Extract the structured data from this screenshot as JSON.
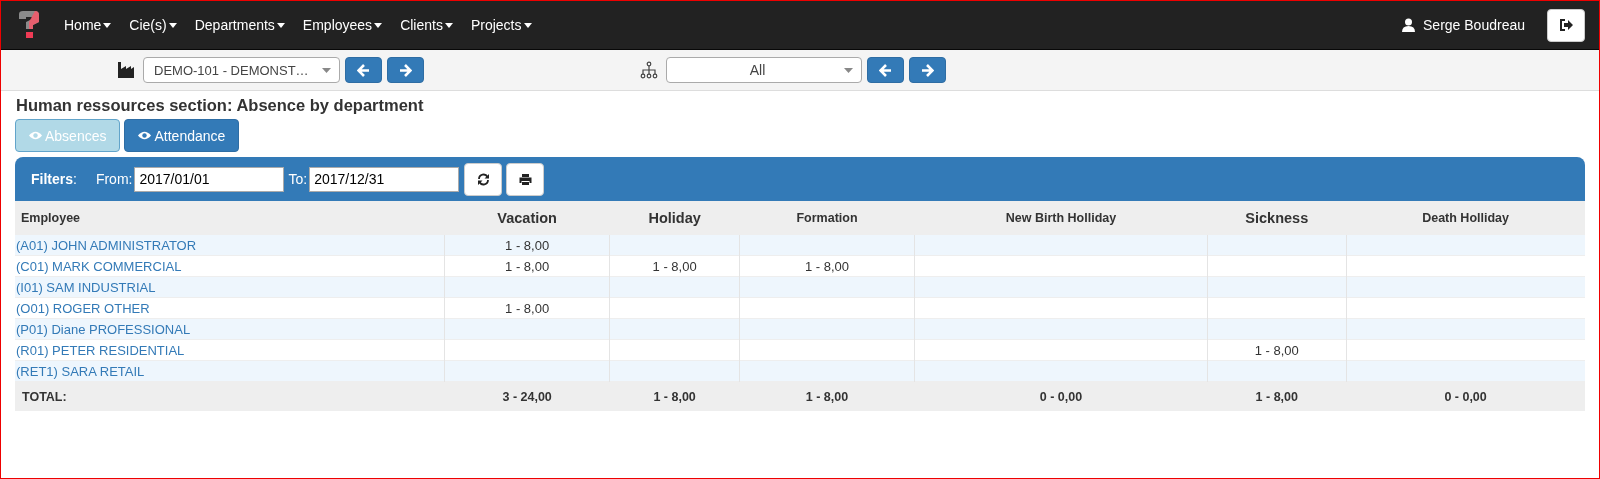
{
  "navbar": {
    "menus": [
      "Home",
      "Cie(s)",
      "Departments",
      "Employees",
      "Clients",
      "Projects"
    ],
    "user": "Serge Boudreau"
  },
  "selectors": {
    "company": "DEMO-101 - DEMONST…",
    "department": "All"
  },
  "title": "Human ressources section: Absence by department",
  "view_buttons": [
    {
      "label": "Absences",
      "disabled": true
    },
    {
      "label": "Attendance",
      "disabled": false
    }
  ],
  "filters": {
    "label": "**Filters**:",
    "from_label": "From:",
    "from": "2017/01/01",
    "to_label": "To:",
    "to": "2017/12/31"
  },
  "table": {
    "columns": [
      {
        "label": "Employee",
        "large": false
      },
      {
        "label": "Vacation",
        "large": true
      },
      {
        "label": "Holiday",
        "large": true
      },
      {
        "label": "Formation",
        "large": false
      },
      {
        "label": "New Birth Holliday",
        "large": false
      },
      {
        "label": "Sickness",
        "large": true
      },
      {
        "label": "Death Holliday",
        "large": false
      }
    ],
    "rows": [
      [
        "(A01) JOHN ADMINISTRATOR",
        "1 - 8,00",
        "",
        "",
        "",
        "",
        ""
      ],
      [
        "(C01) MARK COMMERCIAL",
        "1 - 8,00",
        "1 - 8,00",
        "1 - 8,00",
        "",
        "",
        ""
      ],
      [
        "(I01) SAM INDUSTRIAL",
        "",
        "",
        "",
        "",
        "",
        ""
      ],
      [
        "(O01) ROGER OTHER",
        "1 - 8,00",
        "",
        "",
        "",
        "",
        ""
      ],
      [
        "(P01) Diane PROFESSIONAL",
        "",
        "",
        "",
        "",
        "",
        ""
      ],
      [
        "(R01) PETER RESIDENTIAL",
        "",
        "",
        "",
        "",
        "1 - 8,00",
        ""
      ],
      [
        "(RET1) SARA RETAIL",
        "",
        "",
        "",
        "",
        "",
        ""
      ]
    ],
    "total": [
      "TOTAL:",
      "3 - 24,00",
      "1 - 8,00",
      "1 - 8,00",
      "0 - 0,00",
      "1 - 8,00",
      "0 - 0,00"
    ]
  }
}
